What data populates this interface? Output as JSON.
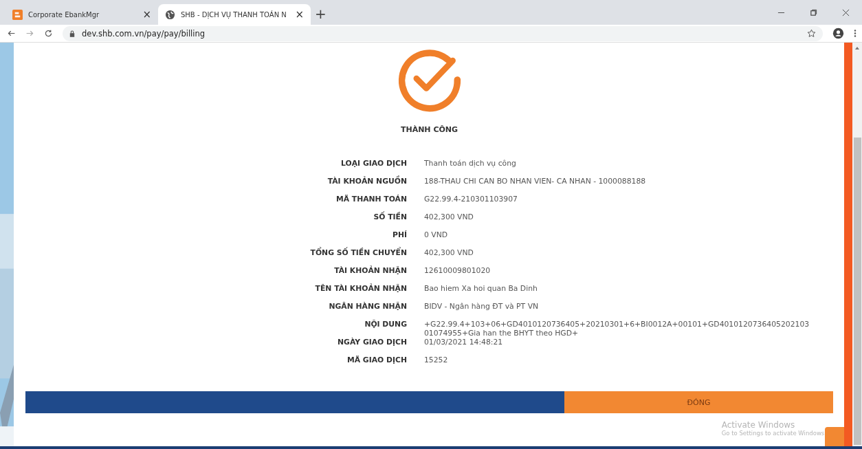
{
  "browser": {
    "tabs": [
      {
        "title": "Corporate EbankMgr",
        "close": "×",
        "selected": false
      },
      {
        "title": "SHB - DỊCH VỤ THANH TOÁN N",
        "close": "×",
        "selected": true
      }
    ],
    "new_tab": "+",
    "url": "dev.shb.com.vn/pay/pay/billing"
  },
  "result": {
    "status": "THÀNH CÔNG"
  },
  "details": [
    {
      "label": "LOẠI GIAO DỊCH",
      "value": "Thanh toán dịch vụ công"
    },
    {
      "label": "TÀI KHOẢN NGUỒN",
      "value": "188-THAU CHI CAN BO NHAN VIEN- CA NHAN - 1000088188"
    },
    {
      "label": "MÃ THANH TOÁN",
      "value": "G22.99.4-210301103907"
    },
    {
      "label": "SỐ TIỀN",
      "value": "402,300 VND"
    },
    {
      "label": "PHÍ",
      "value": "0 VND"
    },
    {
      "label": "TỔNG SỐ TIỀN CHUYỂN",
      "value": "402,300 VND"
    },
    {
      "label": "TÀI KHOẢN NHẬN",
      "value": "12610009801020"
    },
    {
      "label": "TÊN TÀI KHOẢN NHẬN",
      "value": "Bao hiem Xa hoi quan Ba Dinh"
    },
    {
      "label": "NGÂN HÀNG NHẬN",
      "value": "BIDV - Ngân hàng ĐT và PT VN"
    },
    {
      "label": "NỘI DUNG",
      "value": "+G22.99.4+103+06+GD4010120736405+20210301+6+BI0012A+00101+GD4010120736405202103 01074955+Gia han the BHYT theo HGD+"
    },
    {
      "label": "NGÀY GIAO DỊCH",
      "value": "01/03/2021 14:48:21"
    },
    {
      "label": "MÃ GIAO DỊCH",
      "value": "15252"
    }
  ],
  "close_button": "ĐÓNG",
  "os_notice": {
    "title": "Activate Windows",
    "subtitle": "Go to Settings to activate Windows."
  }
}
